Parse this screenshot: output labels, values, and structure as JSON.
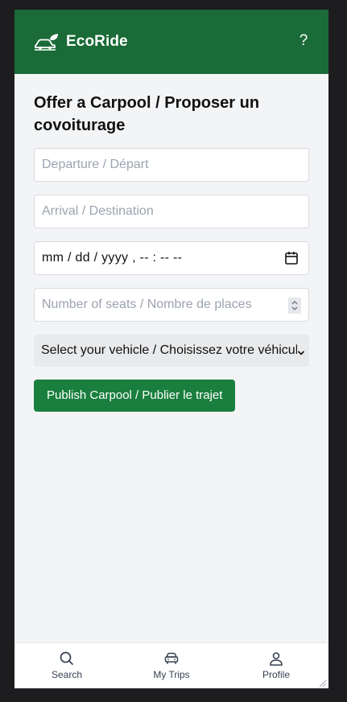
{
  "header": {
    "brand": "EcoRide",
    "help_label": "?",
    "logo_icon": "car-leaf-icon",
    "background": "#1a6b37"
  },
  "form": {
    "title": "Offer a Carpool / Proposer un covoiturage",
    "departure_placeholder": "Departure / Départ",
    "arrival_placeholder": "Arrival / Destination",
    "datetime_value": "mm / dd / yyyy , -- : --  --",
    "seats_placeholder": "Number of seats / Nombre de places",
    "vehicle_selected": "Select your vehicle / Choisissez votre véhicule",
    "publish_label": "Publish Carpool / Publier le trajet",
    "publish_color": "#1a7f3e"
  },
  "nav": {
    "items": [
      {
        "label": "Search",
        "icon": "search-icon"
      },
      {
        "label": "My Trips",
        "icon": "car-icon"
      },
      {
        "label": "Profile",
        "icon": "user-icon"
      }
    ]
  }
}
